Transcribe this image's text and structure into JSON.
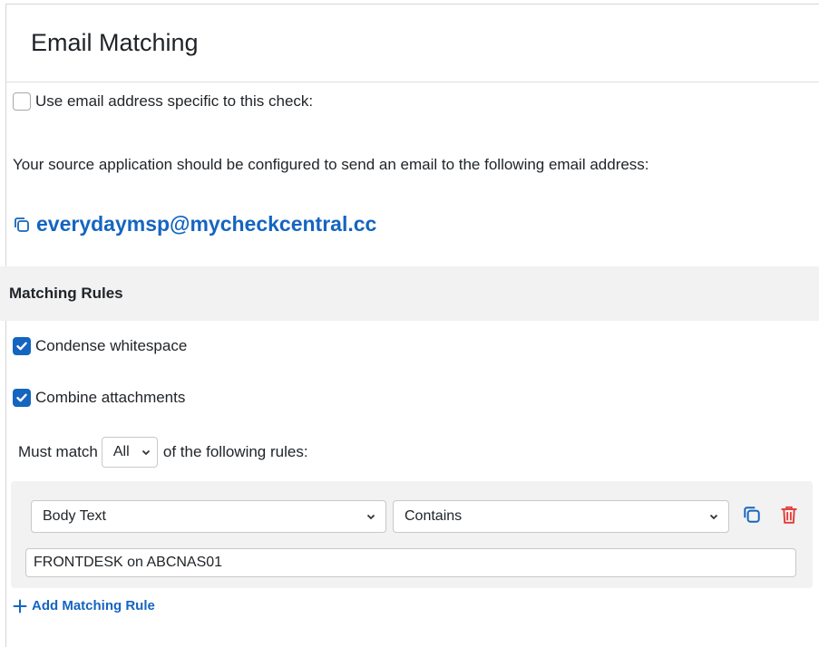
{
  "panel": {
    "title": "Email Matching"
  },
  "email_specific": {
    "label": "Use email address specific to this check:",
    "checked": false
  },
  "instruction_text": "Your source application should be configured to send an email to the following email address:",
  "email_address": "everydaymsp@mycheckcentral.cc",
  "matching_rules": {
    "section_title": "Matching Rules",
    "condense_whitespace": {
      "label": "Condense whitespace",
      "checked": true
    },
    "combine_attachments": {
      "label": "Combine attachments",
      "checked": true
    },
    "must_match_prefix": "Must match",
    "must_match_value": "All",
    "must_match_suffix": "of the following rules:",
    "rules": [
      {
        "field": "Body Text",
        "operator": "Contains",
        "value": "FRONTDESK on ABCNAS01"
      }
    ],
    "add_rule_label": "Add Matching Rule"
  },
  "colors": {
    "accent": "#1565c0",
    "danger": "#e53935",
    "band": "#f2f2f2"
  }
}
